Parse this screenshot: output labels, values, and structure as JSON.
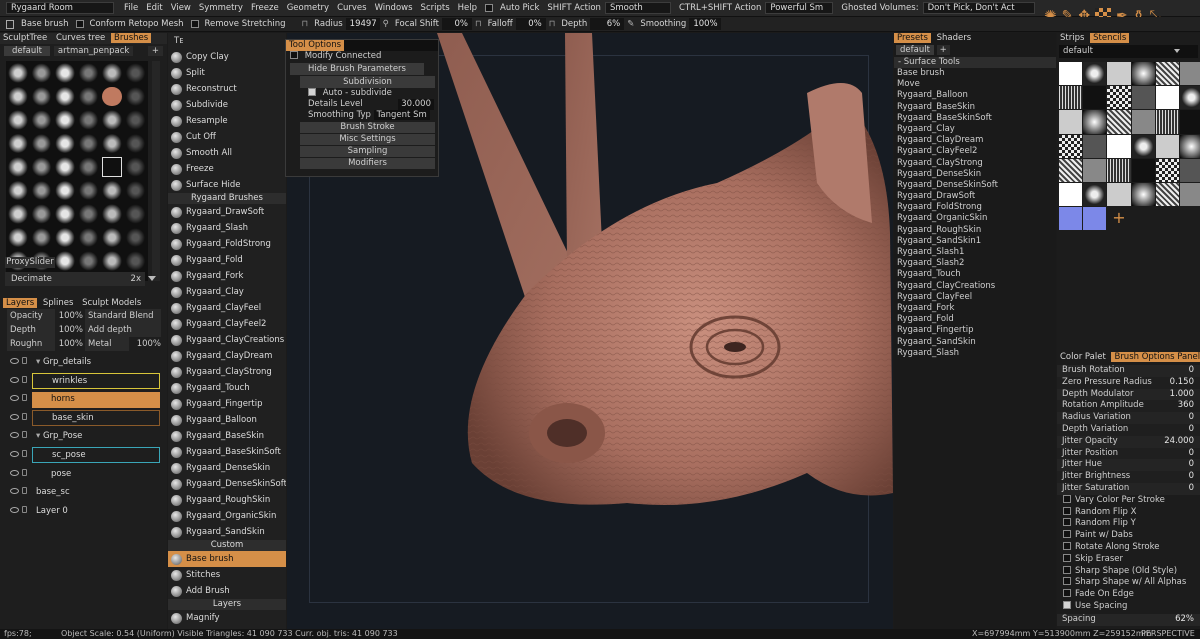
{
  "menubar": {
    "room": "Rygaard Room",
    "items": [
      "File",
      "Edit",
      "View",
      "Symmetry",
      "Freeze",
      "Geometry",
      "Curves",
      "Windows",
      "Scripts",
      "Help"
    ],
    "auto_pick": "Auto Pick",
    "shift_action_label": "SHIFT Action",
    "shift_action_value": "Smooth",
    "ctrl_shift_label": "CTRL+SHIFT Action",
    "ctrl_shift_value": "Powerful Sm",
    "ghosted_label": "Ghosted Volumes:",
    "ghosted_value": "Don't Pick, Don't Act"
  },
  "toolbar": {
    "brush": "Base brush",
    "conform": "Conform Retopo Mesh",
    "remove_stretching": "Remove Stretching",
    "radius_label": "Radius",
    "radius_value": "19497",
    "focal_label": "Focal Shift",
    "focal_value": "0%",
    "falloff_label": "Falloff",
    "falloff_value": "0%",
    "depth_label": "Depth",
    "depth_value": "6%",
    "smoothing_label": "Smoothing",
    "smoothing_value": "100%"
  },
  "left_panel": {
    "tabs": [
      "SculptTree",
      "Curves tree",
      "Brushes"
    ],
    "sub_tabs": [
      "default",
      "artman_penpack"
    ],
    "add": "+",
    "proxy_tab": "ProxySlider",
    "decimate_label": "Decimate",
    "decimate_value": "2x",
    "layer_tabs": [
      "Layers",
      "Splines",
      "Sculpt Models"
    ],
    "opacity_label": "Opacity",
    "opacity_value": "100%",
    "blend": "Standard Blend",
    "depth_label": "Depth",
    "depth_value": "100%",
    "add_depth": "Add depth",
    "rough_label": "Roughn",
    "rough_value": "100%",
    "metal_label": "Metal",
    "metal_value": "100%",
    "layers": [
      {
        "name": "Grp_details",
        "indent": 0,
        "group": true
      },
      {
        "name": "wrinkles",
        "indent": 1,
        "style": "yellow"
      },
      {
        "name": "horns",
        "indent": 1,
        "style": "selected"
      },
      {
        "name": "base_skin",
        "indent": 1,
        "style": "brown"
      },
      {
        "name": "Grp_Pose",
        "indent": 0,
        "group": true
      },
      {
        "name": "sc_pose",
        "indent": 1,
        "style": "cyan"
      },
      {
        "name": "pose",
        "indent": 1
      },
      {
        "name": "base_sc",
        "indent": 0
      },
      {
        "name": "Layer 0",
        "indent": 0
      }
    ]
  },
  "tools": {
    "items": [
      "Copy Clay",
      "Split",
      "Reconstruct",
      "Subdivide",
      "Resample",
      "Cut Off",
      "Smooth All",
      "Freeze",
      "Surface Hide"
    ],
    "rygaard_header": "Rygaard Brushes",
    "rygaard": [
      "Rygaard_DrawSoft",
      "Rygaard_Slash",
      "Rygaard_FoldStrong",
      "Rygaard_Fold",
      "Rygaard_Fork",
      "Rygaard_Clay",
      "Rygaard_ClayFeel",
      "Rygaard_ClayFeel2",
      "Rygaard_ClayCreations",
      "Rygaard_ClayDream",
      "Rygaard_ClayStrong",
      "Rygaard_Touch",
      "Rygaard_Fingertip",
      "Rygaard_Balloon",
      "Rygaard_BaseSkin",
      "Rygaard_BaseSkinSoft",
      "Rygaard_DenseSkin",
      "Rygaard_DenseSkinSoft",
      "Rygaard_RoughSkin",
      "Rygaard_OrganicSkin",
      "Rygaard_SandSkin"
    ],
    "custom_header": "Custom",
    "custom": [
      "Base brush",
      "Stitches",
      "Add Brush"
    ],
    "layers_header": "Layers",
    "layers": [
      "Magnify"
    ]
  },
  "tool_options": {
    "title": "Tool Options",
    "modify_connected": "Modify Connected",
    "hide_params": "Hide Brush Parameters",
    "subdivision": "Subdivision",
    "auto_subdivide": "Auto - subdivide",
    "details_label": "Details Level",
    "details_value": "30.000",
    "smoothing_type": "Smoothing Typ",
    "smoothing_type_value": "Tangent Sm",
    "sections": [
      "Brush Stroke",
      "Misc Settings",
      "Sampling",
      "Modifiers"
    ]
  },
  "presets": {
    "tabs": [
      "Presets",
      "Shaders"
    ],
    "sub_tab": "default",
    "header": "Surface Tools",
    "items": [
      "Base brush",
      "Move",
      "Rygaard_Balloon",
      "Rygaard_BaseSkin",
      "Rygaard_BaseSkinSoft",
      "Rygaard_Clay",
      "Rygaard_ClayDream",
      "Rygaard_ClayFeel2",
      "Rygaard_ClayStrong",
      "Rygaard_DenseSkin",
      "Rygaard_DenseSkinSoft",
      "Rygaard_DrawSoft",
      "Rygaard_FoldStrong",
      "Rygaard_OrganicSkin",
      "Rygaard_RoughSkin",
      "Rygaard_SandSkin1",
      "Rygaard_Slash1",
      "Rygaard_Slash2",
      "Rygaard_Touch",
      "Rygaard_ClayCreations",
      "Rygaard_ClayFeel",
      "Rygaard_Fork",
      "Rygaard_Fold",
      "Rygaard_Fingertip",
      "Rygaard_SandSkin",
      "Rygaard_Slash"
    ]
  },
  "stencils": {
    "tabs": [
      "Strips",
      "Stencils"
    ],
    "dropdown": "default",
    "add": "+"
  },
  "brush_options": {
    "tabs": [
      "Color Palet",
      "Brush Options Panel"
    ],
    "params": [
      {
        "label": "Brush Rotation",
        "value": "0"
      },
      {
        "label": "Zero Pressure Radius",
        "value": "0.150"
      },
      {
        "label": "Depth Modulator",
        "value": "1.000"
      },
      {
        "label": "Rotation Amplitude",
        "value": "360"
      },
      {
        "label": "Radius Variation",
        "value": "0"
      },
      {
        "label": "Depth Variation",
        "value": "0"
      },
      {
        "label": "Jitter Opacity",
        "value": "24.000"
      },
      {
        "label": "Jitter Position",
        "value": "0"
      },
      {
        "label": "Jitter Hue",
        "value": "0"
      },
      {
        "label": "Jitter Brightness",
        "value": "0"
      },
      {
        "label": "Jitter Saturation",
        "value": "0"
      }
    ],
    "checks": [
      {
        "label": "Vary Color Per Stroke",
        "on": false
      },
      {
        "label": "Random Flip X",
        "on": false
      },
      {
        "label": "Random Flip Y",
        "on": false
      },
      {
        "label": "Paint w/ Dabs",
        "on": false
      },
      {
        "label": "Rotate Along Stroke",
        "on": false
      },
      {
        "label": "Skip Eraser",
        "on": false
      },
      {
        "label": "Sharp Shape (Old Style)",
        "on": false
      },
      {
        "label": "Sharp Shape w/ All Alphas",
        "on": false
      },
      {
        "label": "Fade On Edge",
        "on": false
      },
      {
        "label": "Use Spacing",
        "on": true
      }
    ],
    "spacing_label": "Spacing",
    "spacing_value": "62%"
  },
  "status": {
    "fps": "fps:78;",
    "info": "Object Scale: 0.54 (Uniform) Visible Triangles: 41 090 733 Curr. obj. tris: 41 090 733",
    "coords": "X=697994mm Y=513900mm Z=259152mm",
    "view": "PERSPECTIVE"
  }
}
